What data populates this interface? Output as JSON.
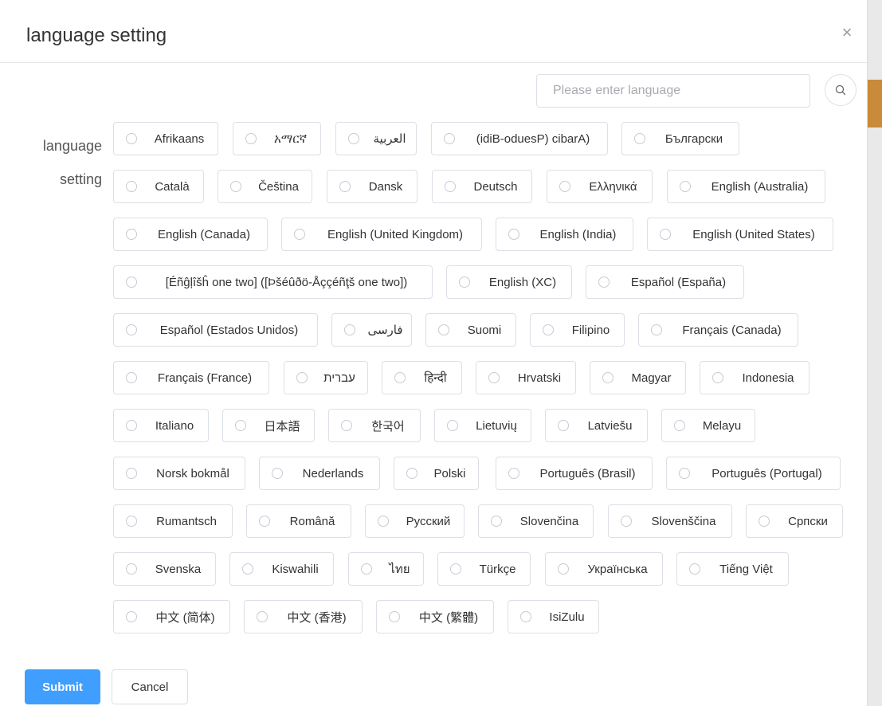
{
  "dialog": {
    "title": "language setting",
    "close_icon": "×"
  },
  "search": {
    "placeholder": "Please enter language",
    "value": ""
  },
  "field_label": "language setting",
  "languages": [
    "Afrikaans",
    "አማርኛ",
    "العربية",
    "(idiB-oduesP) cibarA)",
    "Български",
    "Català",
    "Čeština",
    "Dansk",
    "Deutsch",
    "Ελληνικά",
    "English (Australia)",
    "English (Canada)",
    "English (United Kingdom)",
    "English (India)",
    "English (United States)",
    "[Éñĝļîšĥ one two] ([Þšéûðö-Åççéñţš one two])",
    "English (XC)",
    "Español (España)",
    "Español (Estados Unidos)",
    "فارسی",
    "Suomi",
    "Filipino",
    "Français (Canada)",
    "Français (France)",
    "עברית",
    "हिन्दी",
    "Hrvatski",
    "Magyar",
    "Indonesia",
    "Italiano",
    "日本語",
    "한국어",
    "Lietuvių",
    "Latviešu",
    "Melayu",
    "Norsk bokmål",
    "Nederlands",
    "Polski",
    "Português (Brasil)",
    "Português (Portugal)",
    "Rumantsch",
    "Română",
    "Русский",
    "Slovenčina",
    "Slovenščina",
    "Српски",
    "Svenska",
    "Kiswahili",
    "ไทย",
    "Türkçe",
    "Українська",
    "Tiếng Việt",
    "中文 (简体)",
    "中文 (香港)",
    "中文 (繁體)",
    "IsiZulu"
  ],
  "buttons": {
    "submit": "Submit",
    "cancel": "Cancel"
  },
  "colors": {
    "primary": "#409eff",
    "border": "#dcdfe6",
    "placeholder": "#a8abb2"
  }
}
